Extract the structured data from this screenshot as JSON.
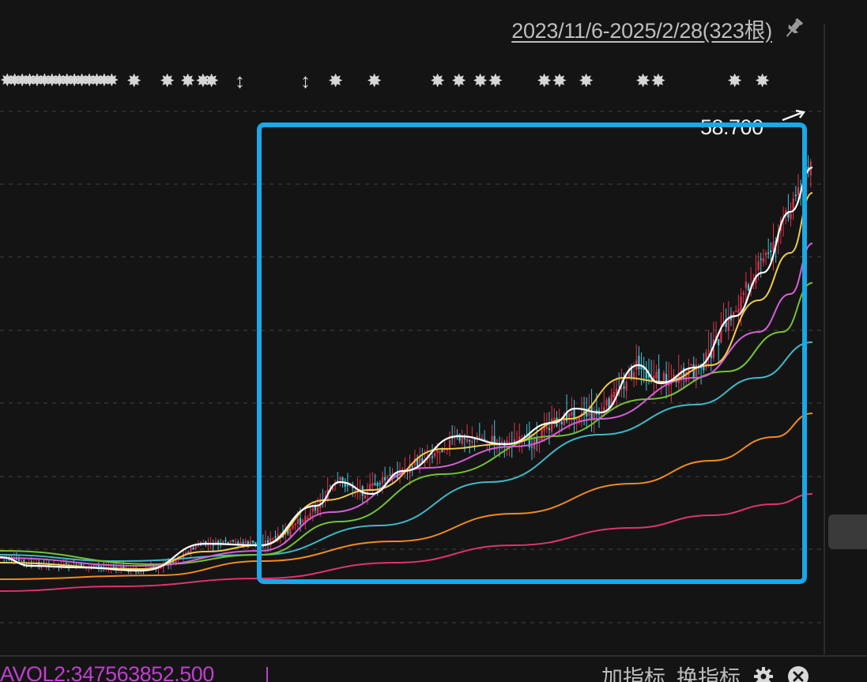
{
  "header": {
    "date_range": "2023/11/6-2025/2/28(323根)"
  },
  "markers": [
    {
      "glyph": "✸✸✸✸✸✸✸✸✸✸✸✸✸✸✸",
      "dense": true
    },
    {
      "glyph": "✸"
    },
    {
      "glyph": "✸"
    },
    {
      "glyph": "✸✸"
    },
    {
      "glyph": "✸"
    },
    {
      "glyph": "↕",
      "arrow": true
    },
    {
      "glyph": "↕",
      "arrow": true
    },
    {
      "glyph": "✸"
    },
    {
      "glyph": "✸"
    },
    {
      "glyph": "✸"
    },
    {
      "glyph": "✸"
    },
    {
      "glyph": "✸✸"
    },
    {
      "glyph": "✸✸"
    },
    {
      "glyph": "✸"
    },
    {
      "glyph": "✸✸"
    },
    {
      "glyph": "✸"
    },
    {
      "glyph": "✸"
    }
  ],
  "chart": {
    "max_label": "58.700"
  },
  "footer": {
    "volume_label": "AVOL2:347563852.500",
    "add_indicator": "加指标",
    "change_indicator": "换指标"
  },
  "icons": {
    "pin": "pin-icon",
    "gear": "gear-icon",
    "close": "close-icon"
  },
  "colors": {
    "background": "#141414",
    "highlight": "#19a8e8",
    "up_candle": "#e0334a",
    "down_candle": "#3cc7d8",
    "ma_white": "#ffffff",
    "ma_yellow": "#f2cc4a",
    "ma_magenta": "#d65ed8",
    "ma_green": "#74c234",
    "ma_cyan": "#3fb8c8",
    "ma_orange": "#f28a1e",
    "ma_pink": "#e0346a",
    "volume_text": "#c03fd0"
  }
}
